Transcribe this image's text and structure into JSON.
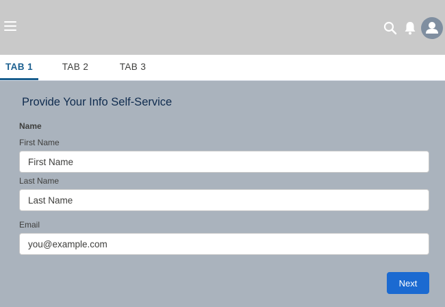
{
  "header": {
    "menu_icon": "hamburger-icon",
    "search_icon": "search-icon",
    "notifications_icon": "bell-icon",
    "avatar_icon": "user-icon"
  },
  "tabs": [
    {
      "label": "TAB 1",
      "active": true
    },
    {
      "label": "TAB 2",
      "active": false
    },
    {
      "label": "TAB 3",
      "active": false
    }
  ],
  "form": {
    "title": "Provide Your Info Self-Service",
    "section_label": "Name",
    "first_name": {
      "label": "First Name",
      "placeholder": "First Name",
      "value": ""
    },
    "last_name": {
      "label": "Last Name",
      "placeholder": "Last Name",
      "value": ""
    },
    "email": {
      "label": "Email",
      "placeholder": "you@example.com",
      "value": ""
    },
    "next_label": "Next"
  },
  "colors": {
    "header_bg": "#c9c9c9",
    "page_bg": "#aab3bd",
    "accent": "#1b5f8f",
    "button_bg": "#1b6ad1"
  }
}
